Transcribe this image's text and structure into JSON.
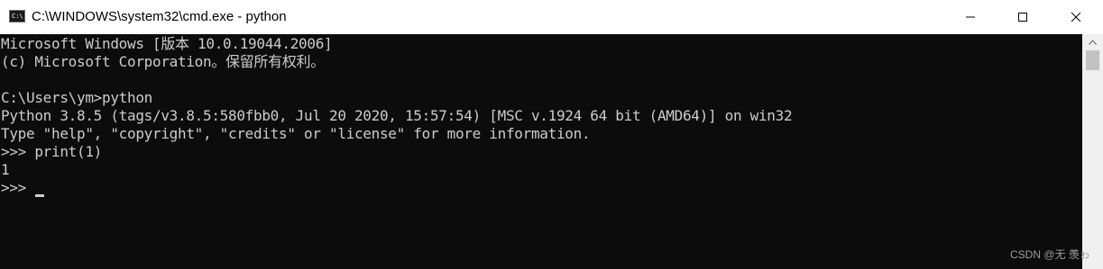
{
  "window": {
    "title": "C:\\WINDOWS\\system32\\cmd.exe - python",
    "icon": "cmd-icon",
    "icon_text": "C:\\",
    "minimize_icon": "minimize-icon",
    "maximize_icon": "maximize-icon",
    "close_icon": "close-icon"
  },
  "console": {
    "lines": [
      "Microsoft Windows [版本 10.0.19044.2006]",
      "(c) Microsoft Corporation。保留所有权利。",
      "",
      "C:\\Users\\ym>python",
      "Python 3.8.5 (tags/v3.8.5:580fbb0, Jul 20 2020, 15:57:54) [MSC v.1924 64 bit (AMD64)] on win32",
      "Type \"help\", \"copyright\", \"credits\" or \"license\" for more information.",
      ">>> print(1)",
      "1",
      ">>> "
    ],
    "background": "#0c0c0c",
    "foreground": "#cccccc"
  },
  "watermark": "CSDN @无 羡ゎ"
}
